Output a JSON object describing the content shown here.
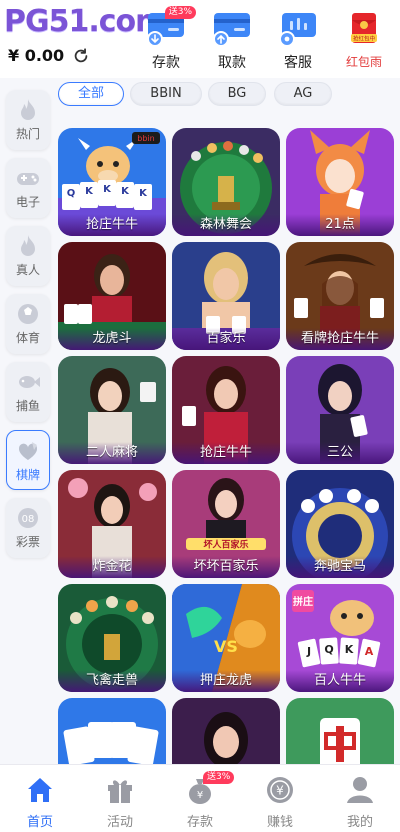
{
  "header": {
    "logo_text": "PG51.com",
    "balance": "¥ 0.00",
    "actions": [
      {
        "label": "存款",
        "icon": "deposit-icon",
        "badge": "送3%"
      },
      {
        "label": "取款",
        "icon": "withdraw-icon",
        "badge": ""
      },
      {
        "label": "客服",
        "icon": "customer-service-icon",
        "badge": ""
      },
      {
        "label": "红包雨",
        "icon": "red-envelope-icon",
        "badge": "",
        "icon_text": "抢红包中"
      }
    ]
  },
  "sidebar": {
    "items": [
      {
        "label": "热门",
        "icon": "flame-icon"
      },
      {
        "label": "电子",
        "icon": "gamepad-icon"
      },
      {
        "label": "真人",
        "icon": "live-dealer-icon"
      },
      {
        "label": "体育",
        "icon": "ball-icon"
      },
      {
        "label": "捕鱼",
        "icon": "fish-icon"
      },
      {
        "label": "棋牌",
        "icon": "cards-icon",
        "active": true
      },
      {
        "label": "彩票",
        "icon": "lottery-icon",
        "icon_text": "08"
      }
    ]
  },
  "filters": [
    {
      "label": "全部",
      "active": true
    },
    {
      "label": "BBIN"
    },
    {
      "label": "BG"
    },
    {
      "label": "AG"
    }
  ],
  "games": [
    {
      "title": "抢庄牛牛",
      "art_text": "bbin",
      "card_text": [
        "Q",
        "K",
        "K",
        "K",
        "K"
      ]
    },
    {
      "title": "森林舞会"
    },
    {
      "title": "21点"
    },
    {
      "title": "龙虎斗"
    },
    {
      "title": "百家乐"
    },
    {
      "title": "看牌抢庄牛牛"
    },
    {
      "title": "二人麻将"
    },
    {
      "title": "抢庄牛牛"
    },
    {
      "title": "三公"
    },
    {
      "title": "炸金花"
    },
    {
      "title": "坏坏百家乐",
      "art_text": "坏人百家乐"
    },
    {
      "title": "奔驰宝马"
    },
    {
      "title": "飞禽走兽"
    },
    {
      "title": "押庄龙虎"
    },
    {
      "title": "百人牛牛",
      "art_text": "拼庄",
      "card_text": [
        "J",
        "Q",
        "K",
        "A"
      ]
    },
    {
      "title": ""
    },
    {
      "title": ""
    },
    {
      "title": ""
    }
  ],
  "bottom_nav": [
    {
      "label": "首页",
      "icon": "home-icon",
      "active": true
    },
    {
      "label": "活动",
      "icon": "gift-icon"
    },
    {
      "label": "存款",
      "icon": "money-bag-icon",
      "badge": "送3%"
    },
    {
      "label": "赚钱",
      "icon": "yen-coin-icon"
    },
    {
      "label": "我的",
      "icon": "user-icon"
    }
  ],
  "colors": {
    "accent_blue": "#3a7bff",
    "logo_purple": "#7b54d6",
    "badge_red": "#ff3b5c",
    "card_caption": "#46147a"
  }
}
